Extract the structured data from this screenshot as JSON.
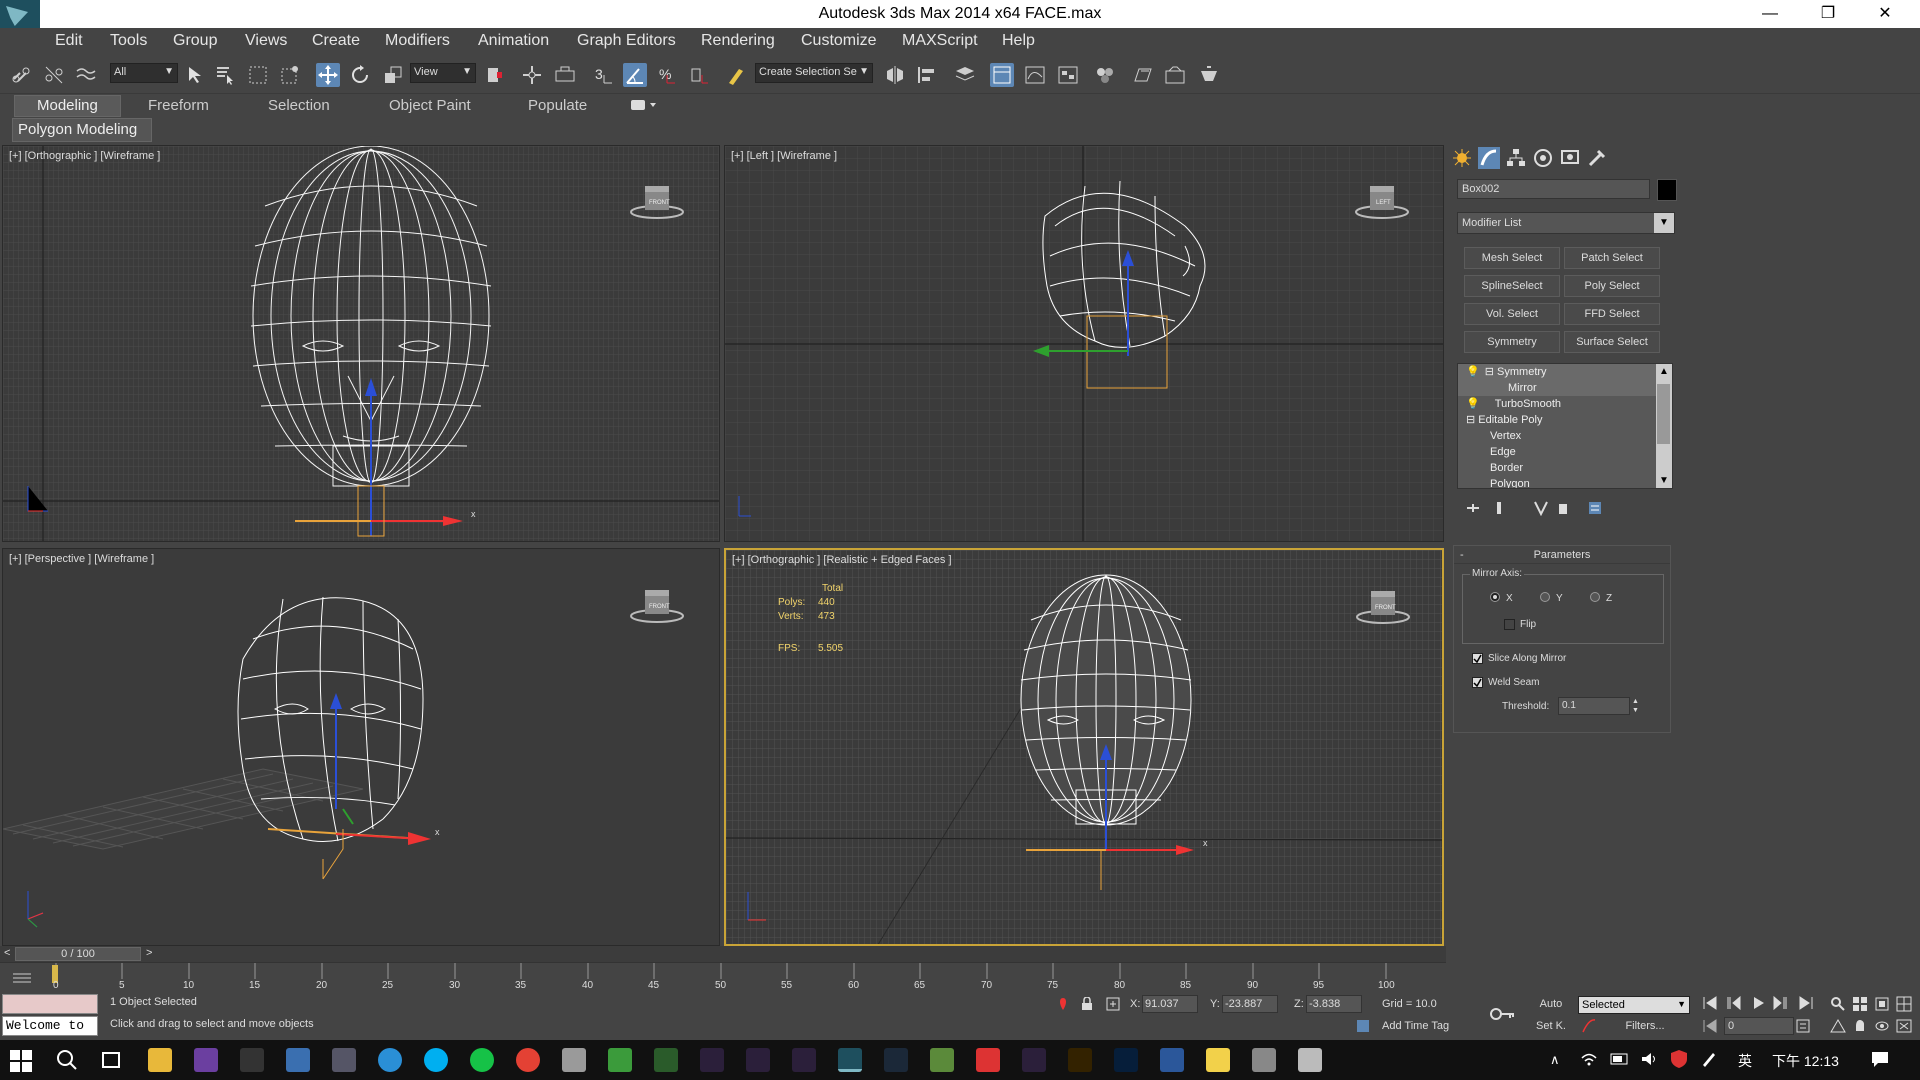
{
  "window": {
    "title": "Autodesk 3ds Max  2014 x64      FACE.max",
    "minimize": "—",
    "restore": "❐",
    "close": "✕"
  },
  "menu": [
    "Edit",
    "Tools",
    "Group",
    "Views",
    "Create",
    "Modifiers",
    "Animation",
    "Graph Editors",
    "Rendering",
    "Customize",
    "MAXScript",
    "Help"
  ],
  "toolbar": {
    "filter_value": "All",
    "refcoord_value": "View",
    "selection_set_placeholder": "Create Selection Se",
    "snap_angle_label": "3",
    "percent_label": "%"
  },
  "ribbon": {
    "tabs": [
      "Modeling",
      "Freeform",
      "Selection",
      "Object Paint",
      "Populate"
    ],
    "active_tab": "Modeling",
    "sub_panel": "Polygon Modeling"
  },
  "viewports": {
    "top_left": {
      "label": "[+] [Orthographic ] [Wireframe ]",
      "cube": "FRONT"
    },
    "top_right": {
      "label": "[+] [Left ] [Wireframe ]",
      "cube": "LEFT"
    },
    "bottom_left": {
      "label": "[+] [Perspective ] [Wireframe ]",
      "cube": "FRONT"
    },
    "bottom_right": {
      "label": "[+] [Orthographic ] [Realistic + Edged Faces ]",
      "cube": "FRONT",
      "stats": {
        "total_label": "Total",
        "polys_label": "Polys:",
        "polys": "440",
        "verts_label": "Verts:",
        "verts": "473",
        "fps_label": "FPS:",
        "fps": "5.505"
      }
    },
    "axis_x": "x",
    "axis_y": "y",
    "axis_z": "z"
  },
  "command_panel": {
    "object_name": "Box002",
    "object_color": "#000000",
    "modifier_list": "Modifier List",
    "modifier_buttons": [
      "Mesh Select",
      "Patch Select",
      "SplineSelect",
      "Poly Select",
      "Vol. Select",
      "FFD Select",
      "Symmetry",
      "Surface Select"
    ],
    "stack": [
      {
        "label": "Symmetry",
        "level": 1,
        "selected": true
      },
      {
        "label": "Mirror",
        "level": 2,
        "selected": true
      },
      {
        "label": "TurboSmooth",
        "level": 1,
        "selected": false
      },
      {
        "label": "Editable Poly",
        "level": 0,
        "selected": false
      },
      {
        "label": "Vertex",
        "level": 2,
        "selected": false
      },
      {
        "label": "Edge",
        "level": 2,
        "selected": false
      },
      {
        "label": "Border",
        "level": 2,
        "selected": false
      },
      {
        "label": "Polygon",
        "level": 2,
        "selected": false
      }
    ],
    "parameters": {
      "title": "Parameters",
      "collapse": "-",
      "mirror_axis_label": "Mirror Axis:",
      "axes": [
        "X",
        "Y",
        "Z"
      ],
      "selected_axis": "X",
      "flip_label": "Flip",
      "slice_label": "Slice Along Mirror",
      "weld_label": "Weld Seam",
      "threshold_label": "Threshold:",
      "threshold_value": "0.1"
    }
  },
  "timeline": {
    "frame": "0 / 100",
    "prev": "<",
    "next": ">",
    "ticks": [
      "0",
      "5",
      "10",
      "15",
      "20",
      "25",
      "30",
      "35",
      "40",
      "45",
      "50",
      "55",
      "60",
      "65",
      "70",
      "75",
      "80",
      "85",
      "90",
      "95",
      "100"
    ]
  },
  "status": {
    "script_text": "Welcome to",
    "selected_text": "1 Object Selected",
    "prompt_text": "Click and drag to select and move objects",
    "x_label": "X:",
    "x_value": "91.037",
    "y_label": "Y:",
    "y_value": "-23.887",
    "z_label": "Z:",
    "z_value": "-3.838",
    "grid": "Grid = 10.0",
    "add_time_tag": "Add Time Tag",
    "auto_label": "Auto",
    "setk_label": "Set K.",
    "selected_dropdown": "Selected",
    "filters_label": "Filters...",
    "frame_field": "0"
  },
  "taskbar": {
    "ime": "英",
    "time": "下午 12:13"
  }
}
